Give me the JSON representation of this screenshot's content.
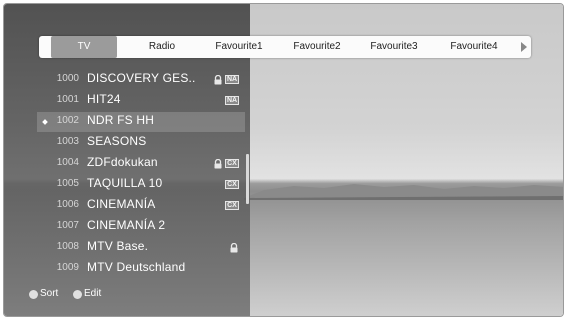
{
  "tabs": [
    {
      "label": "TV"
    },
    {
      "label": "Radio"
    },
    {
      "label": "Favourite1"
    },
    {
      "label": "Favourite2"
    },
    {
      "label": "Favourite3"
    },
    {
      "label": "Favourite4"
    }
  ],
  "selected_tab": "TV",
  "channels": [
    {
      "number": "1000",
      "name": "DISCOVERY GES..",
      "locked": true,
      "badge": "NA"
    },
    {
      "number": "1001",
      "name": "HIT24",
      "locked": false,
      "badge": "NA"
    },
    {
      "number": "1002",
      "name": "NDR FS HH",
      "locked": false,
      "badge": null,
      "selected": true
    },
    {
      "number": "1003",
      "name": "SEASONS",
      "locked": false,
      "badge": null
    },
    {
      "number": "1004",
      "name": "ZDFdokukan",
      "locked": true,
      "badge": "CX"
    },
    {
      "number": "1005",
      "name": "TAQUILLA 10",
      "locked": false,
      "badge": "CX"
    },
    {
      "number": "1006",
      "name": "CINEMANÍA",
      "locked": false,
      "badge": "CX"
    },
    {
      "number": "1007",
      "name": "CINEMANÍA 2",
      "locked": false,
      "badge": null
    },
    {
      "number": "1008",
      "name": "MTV Base.",
      "locked": true,
      "badge": null
    },
    {
      "number": "1009",
      "name": "MTV Deutschland",
      "locked": false,
      "badge": null
    }
  ],
  "footer": {
    "sort_label": "Sort",
    "edit_label": "Edit",
    "sort_color": "#e0e0e0",
    "edit_color": "#e0e0e0"
  },
  "icons": {
    "lock": "lock-icon",
    "scroll_right": "arrow-right-icon",
    "selected_marker": "diamond-icon"
  }
}
